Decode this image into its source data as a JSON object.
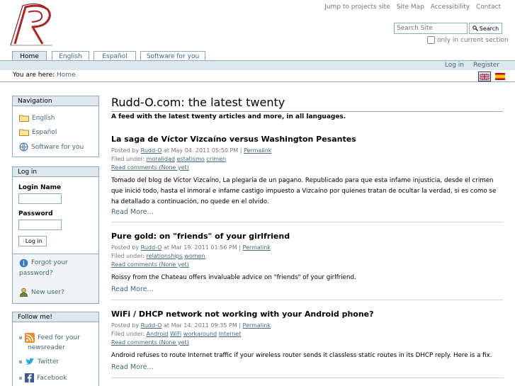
{
  "site_actions": [
    "Jump to projects site",
    "Site Map",
    "Accessibility",
    "Contact"
  ],
  "search": {
    "placeholder": "Search Site",
    "button": "Search",
    "scope_label": "only in current section"
  },
  "tabs": [
    "Home",
    "English",
    "Español",
    "Software for you"
  ],
  "personal_bar": {
    "login": "Log in",
    "register": "Register"
  },
  "breadcrumb": {
    "prefix": "You are here:",
    "home": "Home"
  },
  "nav_portlet": {
    "title": "Navigation",
    "items": [
      "English",
      "Español",
      "Software for you"
    ]
  },
  "login_portlet": {
    "title": "Log in",
    "login_name_label": "Login Name",
    "password_label": "Password",
    "button": "Log in",
    "forgot_line1": "Forgot your",
    "forgot_line2": "password?",
    "new_user": "New user?"
  },
  "follow_portlet": {
    "title": "Follow me!",
    "feed_line1": "Feed for your",
    "feed_line2": "newsreader",
    "twitter": "Twitter",
    "facebook": "Facebook"
  },
  "main": {
    "title": "Rudd-O.com: the latest twenty",
    "description": "A feed with the latest twenty articles and more, in all languages.",
    "read_more": "Read More…",
    "articles": [
      {
        "title": "La saga de Víctor Vizcaíno versus Washington Pesantes",
        "posted_by": "Posted by",
        "author": "Rudd-O",
        "date": "at May 04. 2011 05:50 PM |",
        "permalink": "Permalink",
        "filed_under": "Filed under:",
        "tags": [
          "moralidad",
          "estatismo",
          "crimen"
        ],
        "comments": "Read comments (None yet)",
        "body": "Tomado del blog de Víctor Vizcaíno, La plegaria de un pagano. Republicado para que esta infame injusticia, desde el crimen que inició todo, hasta el inmoral e infame castigo impuesto a Vizcaíno por quienes tratan de ocultar la verdad, si es como se ha detallado a continuación, no quede en el olvido."
      },
      {
        "title": "Pure gold: on \"friends\" of your girlfriend",
        "posted_by": "Posted by",
        "author": "Rudd-O",
        "date": "at Mar 19. 2011 01:56 PM |",
        "permalink": "Permalink",
        "filed_under": "Filed under:",
        "tags": [
          "relationships",
          "women"
        ],
        "comments": "Read comments (None yet)",
        "body": "Roissy from the Chateau offers invaluable advice on \"friends\" of your girlfriend."
      },
      {
        "title": "WiFi / DHCP network not working with your Android phone?",
        "posted_by": "Posted by",
        "author": "Rudd-O",
        "date": "at Mar 14. 2011 09:35 PM |",
        "permalink": "Permalink",
        "filed_under": "Filed under:",
        "tags": [
          "Android",
          "WiFi",
          "workaround",
          "Internet"
        ],
        "comments": "Read comments (None yet)",
        "body": "Android refuses to route Internet traffic if your wireless router sends it classless static routes in its DHCP reply. Here is a fix."
      }
    ]
  },
  "colors": {
    "accent": "#436976",
    "border": "#8cacbb",
    "bar_bg": "#dee7ec",
    "logo": "#b22222"
  },
  "icons": [
    "folder-icon",
    "globe-icon",
    "info-icon",
    "user-icon",
    "rss-icon",
    "twitter-bird-icon",
    "facebook-icon",
    "flag-uk-icon",
    "flag-spain-icon",
    "magnifier-icon"
  ]
}
